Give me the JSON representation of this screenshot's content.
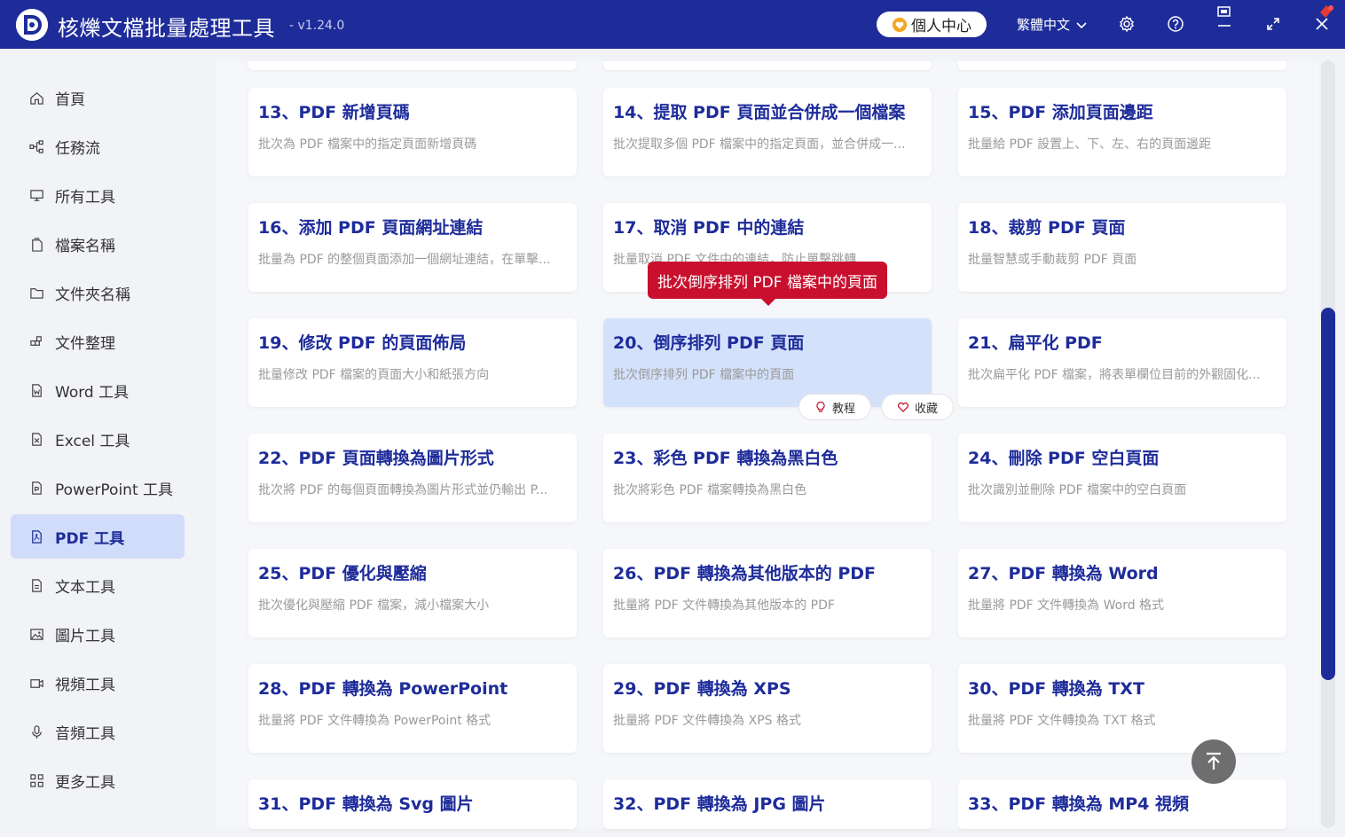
{
  "app": {
    "title": "核爍文檔批量處理工具",
    "version": "- v1.24.0",
    "user_center": "個人中心",
    "language": "繁體中文"
  },
  "sidebar": {
    "items": [
      {
        "label": "首頁",
        "icon": "home-icon"
      },
      {
        "label": "任務流",
        "icon": "workflow-icon"
      },
      {
        "label": "所有工具",
        "icon": "monitor-icon"
      },
      {
        "label": "檔案名稱",
        "icon": "file-name-icon"
      },
      {
        "label": "文件夾名稱",
        "icon": "folder-icon"
      },
      {
        "label": "文件整理",
        "icon": "organize-icon"
      },
      {
        "label": "Word 工具",
        "icon": "word-icon"
      },
      {
        "label": "Excel 工具",
        "icon": "excel-icon"
      },
      {
        "label": "PowerPoint 工具",
        "icon": "powerpoint-icon"
      },
      {
        "label": "PDF 工具",
        "icon": "pdf-icon",
        "active": true
      },
      {
        "label": "文本工具",
        "icon": "text-icon"
      },
      {
        "label": "圖片工具",
        "icon": "image-icon"
      },
      {
        "label": "視頻工具",
        "icon": "video-icon"
      },
      {
        "label": "音頻工具",
        "icon": "microphone-icon"
      },
      {
        "label": "更多工具",
        "icon": "grid-icon"
      }
    ]
  },
  "cards": [
    {
      "title": "13、PDF 新增頁碼",
      "desc": "批次為 PDF 檔案中的指定頁面新增頁碼"
    },
    {
      "title": "14、提取 PDF 頁面並合併成一個檔案",
      "desc": "批次提取多個 PDF 檔案中的指定頁面，並合併成一..."
    },
    {
      "title": "15、PDF 添加頁面邊距",
      "desc": "批量給 PDF 設置上、下、左、右的頁面邊距"
    },
    {
      "title": "16、添加 PDF 頁面網址連結",
      "desc": "批量為 PDF 的整個頁面添加一個網址連結，在單擊..."
    },
    {
      "title": "17、取消 PDF 中的連結",
      "desc": "批量取消 PDF 文件中的連結，防止單擊跳轉"
    },
    {
      "title": "18、裁剪 PDF 頁面",
      "desc": "批量智慧或手動裁剪 PDF 頁面"
    },
    {
      "title": "19、修改 PDF 的頁面佈局",
      "desc": "批量修改 PDF 檔案的頁面大小和紙張方向"
    },
    {
      "title": "20、倒序排列 PDF 頁面",
      "desc": "批次倒序排列 PDF 檔案中的頁面",
      "active": true
    },
    {
      "title": "21、扁平化 PDF",
      "desc": "批次扁平化 PDF 檔案，將表單欄位目前的外觀固化..."
    },
    {
      "title": "22、PDF 頁面轉換為圖片形式",
      "desc": "批次將 PDF 的每個頁面轉換為圖片形式並仍輸出 P..."
    },
    {
      "title": "23、彩色 PDF 轉換為黑白色",
      "desc": "批次將彩色 PDF 檔案轉換為黑白色"
    },
    {
      "title": "24、刪除 PDF 空白頁面",
      "desc": "批次識別並刪除 PDF 檔案中的空白頁面"
    },
    {
      "title": "25、PDF 優化與壓縮",
      "desc": "批次優化與壓縮 PDF 檔案，減小檔案大小"
    },
    {
      "title": "26、PDF 轉換為其他版本的 PDF",
      "desc": "批量將 PDF 文件轉換為其他版本的 PDF"
    },
    {
      "title": "27、PDF 轉換為 Word",
      "desc": "批量將 PDF 文件轉換為 Word 格式"
    },
    {
      "title": "28、PDF 轉換為 PowerPoint",
      "desc": "批量將 PDF 文件轉換為 PowerPoint 格式"
    },
    {
      "title": "29、PDF 轉換為 XPS",
      "desc": "批量將 PDF 文件轉換為 XPS 格式"
    },
    {
      "title": "30、PDF 轉換為 TXT",
      "desc": "批量將 PDF 文件轉換為 TXT 格式"
    },
    {
      "title": "31、PDF 轉換為 Svg 圖片",
      "desc": ""
    },
    {
      "title": "32、PDF 轉換為 JPG 圖片",
      "desc": ""
    },
    {
      "title": "33、PDF 轉換為 MP4 視頻",
      "desc": ""
    }
  ],
  "card_actions": {
    "tutorial": "教程",
    "favorite": "收藏"
  },
  "tooltip": "批次倒序排列 PDF 檔案中的頁面",
  "colors": {
    "brand": "#1e2c9a",
    "active_bg": "#d0dcf9",
    "tooltip_bg": "#c8102e"
  }
}
